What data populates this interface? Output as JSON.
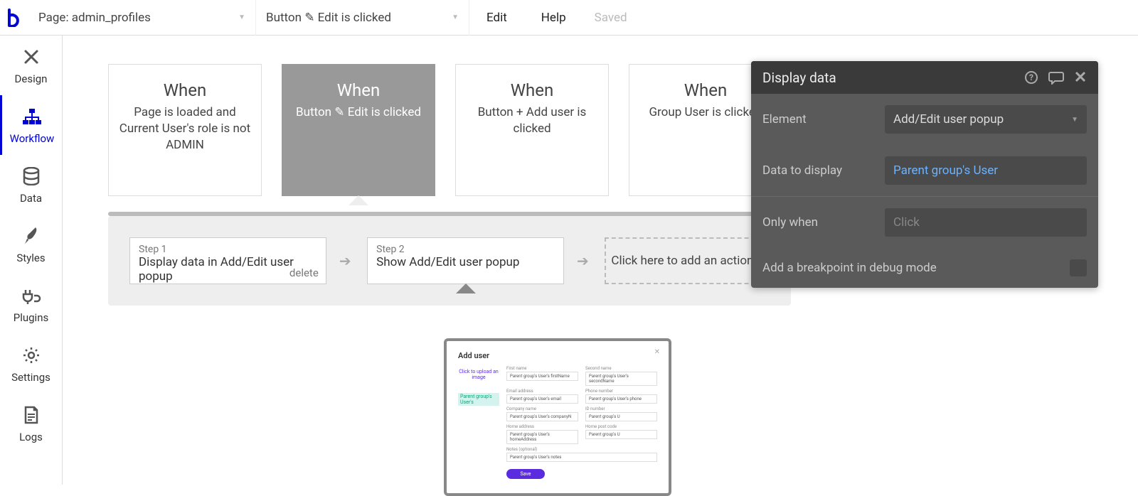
{
  "topbar": {
    "page_label": "Page: admin_profiles",
    "event_label": "Button ✎ Edit is clicked",
    "edit": "Edit",
    "help": "Help",
    "saved": "Saved"
  },
  "sidebar": {
    "items": [
      {
        "label": "Design"
      },
      {
        "label": "Workflow"
      },
      {
        "label": "Data"
      },
      {
        "label": "Styles"
      },
      {
        "label": "Plugins"
      },
      {
        "label": "Settings"
      },
      {
        "label": "Logs"
      }
    ]
  },
  "events": [
    {
      "when": "When",
      "desc": "Page is loaded and Current User's role is not ADMIN"
    },
    {
      "when": "When",
      "desc": "Button ✎ Edit is clicked"
    },
    {
      "when": "When",
      "desc": "Button + Add user is clicked"
    },
    {
      "when": "When",
      "desc": "Group User is clicked"
    }
  ],
  "steps": {
    "s1_lbl": "Step 1",
    "s1_txt": "Display data in Add/Edit user popup",
    "s1_del": "delete",
    "s2_lbl": "Step 2",
    "s2_txt": "Show Add/Edit user popup",
    "add": "Click here to add an action..."
  },
  "preview": {
    "title": "Add user",
    "upload": "Click to upload an image",
    "tag": "Parent group's User's",
    "fields": [
      {
        "lbl": "First name",
        "val": "Parent group's User's firstName"
      },
      {
        "lbl": "Second name",
        "val": "Parent group's User's secondName"
      },
      {
        "lbl": "Email address",
        "val": "Parent group's User's email"
      },
      {
        "lbl": "Phone number",
        "val": "Parent group's User's phone"
      },
      {
        "lbl": "Company name",
        "val": "Parent group's User's companyN"
      },
      {
        "lbl": "ID number",
        "val": "Parent group's U"
      },
      {
        "lbl": "Home address",
        "val": "Parent group's User's homeAddress"
      },
      {
        "lbl": "Home post code",
        "val": "Parent group's U"
      },
      {
        "lbl": "Notes (optional)",
        "val": "Parent group's User's notes"
      }
    ],
    "save": "Save"
  },
  "panel": {
    "title": "Display data",
    "element_lbl": "Element",
    "element_val": "Add/Edit user popup",
    "data_lbl": "Data to display",
    "data_val": "Parent group's User",
    "only_lbl": "Only when",
    "only_placeholder": "Click",
    "breakpoint_lbl": "Add a breakpoint in debug mode"
  }
}
